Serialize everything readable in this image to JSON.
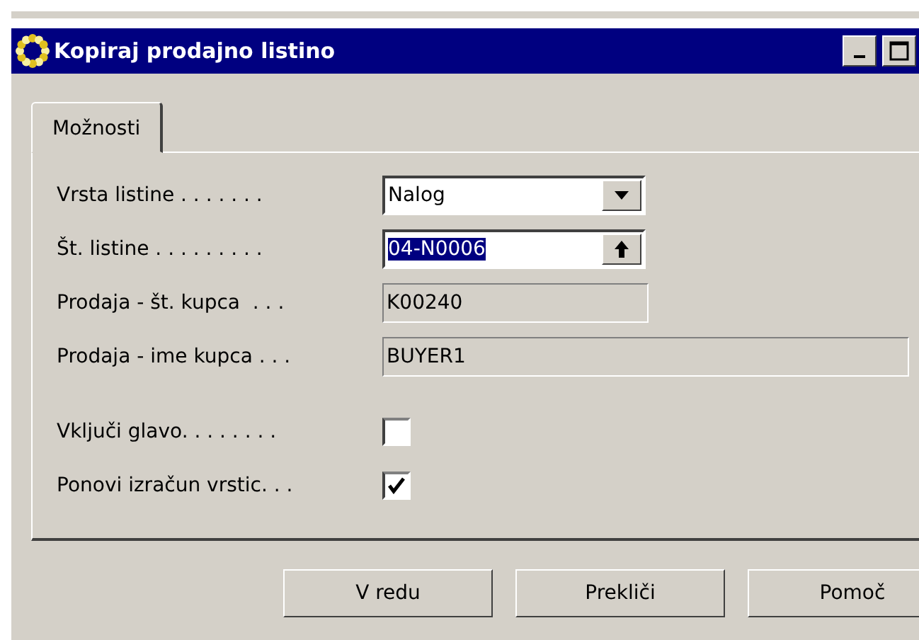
{
  "window": {
    "title": "Kopiraj prodajno listino"
  },
  "tabs": [
    {
      "label": "Možnosti",
      "selected": true
    }
  ],
  "fields": [
    {
      "kind": "dropdown",
      "label": "Vrsta listine . . . . . . .",
      "value": "Nalog",
      "highlighted": false,
      "wide": false
    },
    {
      "kind": "lookup",
      "label": "Št. listine . . . . . . . . .",
      "value": "04-N0006",
      "highlighted": true,
      "wide": false
    },
    {
      "kind": "readonly",
      "label": "Prodaja - št. kupca  . . .",
      "value": "K00240",
      "highlighted": false,
      "wide": false
    },
    {
      "kind": "readonly",
      "label": "Prodaja - ime kupca . . .",
      "value": "BUYER1",
      "highlighted": false,
      "wide": true
    }
  ],
  "checkboxes": [
    {
      "label": "Vključi glavo. . . . . . . .",
      "checked": false
    },
    {
      "label": "Ponovi izračun vrstic. . .",
      "checked": true
    }
  ],
  "buttons": [
    "V redu",
    "Prekliči",
    "Pomoč"
  ]
}
